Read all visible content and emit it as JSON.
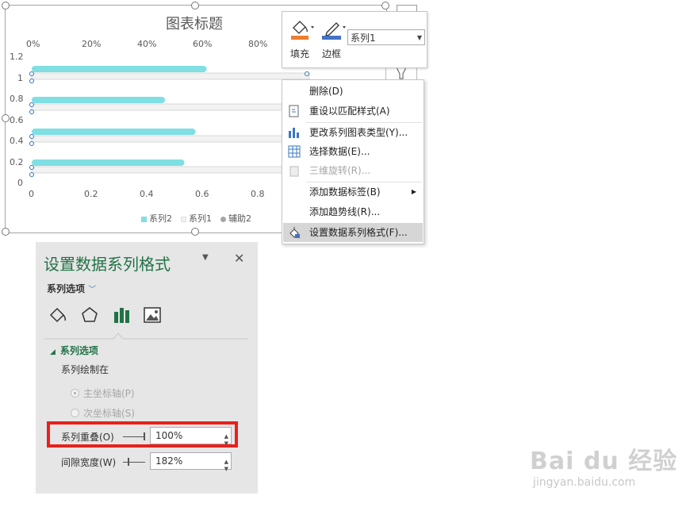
{
  "chart": {
    "title": "图表标题",
    "legend": [
      {
        "name": "系列2",
        "color": "#7fdfe2"
      },
      {
        "name": "系列1",
        "color": "#f2f2f2"
      },
      {
        "name": "辅助2",
        "color": "#a6a6a6"
      }
    ]
  },
  "chart_data": {
    "type": "bar",
    "orientation": "horizontal",
    "title": "图表标题",
    "top_axis_ticks": [
      "0%",
      "20%",
      "40%",
      "60%",
      "80%"
    ],
    "bottom_axis_ticks": [
      "0",
      "0.2",
      "0.4",
      "0.6",
      "0.8"
    ],
    "left_axis_ticks": [
      "1.2",
      "1",
      "0.8",
      "0.6",
      "0.4",
      "0.2",
      "0"
    ],
    "series": [
      {
        "name": "系列2",
        "color": "#7fdfe2",
        "values": [
          0.63,
          0.48,
          0.59,
          0.55
        ]
      },
      {
        "name": "系列1",
        "color": "#f2f2f2",
        "values": [
          1.0,
          1.0,
          1.0,
          1.0
        ]
      }
    ],
    "legend_position": "bottom",
    "grid": false
  },
  "toolbar": {
    "fill_label": "填充",
    "border_label": "边框",
    "series_selected": "系列1",
    "colors": {
      "fill": "#ed7d31",
      "border": "#4472c4"
    }
  },
  "context_menu": {
    "items": [
      {
        "label": "删除(D)",
        "icon": "none",
        "disabled": false
      },
      {
        "label": "重设以匹配样式(A)",
        "icon": "reset-style-icon",
        "disabled": false
      },
      {
        "label": "更改系列图表类型(Y)...",
        "icon": "chart-type-icon",
        "disabled": false
      },
      {
        "label": "选择数据(E)...",
        "icon": "select-data-icon",
        "disabled": false
      },
      {
        "label": "三维旋转(R)...",
        "icon": "rotate-3d-icon",
        "disabled": true
      },
      {
        "label": "添加数据标签(B)",
        "icon": "none",
        "disabled": false
      },
      {
        "label": "添加趋势线(R)...",
        "icon": "none",
        "disabled": false
      },
      {
        "label": "设置数据系列格式(F)...",
        "icon": "format-series-icon",
        "disabled": false
      }
    ]
  },
  "pane": {
    "title": "设置数据系列格式",
    "tab_label": "系列选项",
    "section_header": "系列选项",
    "plot_on_label": "系列绘制在",
    "primary_axis": "主坐标轴(P)",
    "secondary_axis": "次坐标轴(S)",
    "overlap_label": "系列重叠(O)",
    "overlap_value": "100%",
    "gap_label": "间隙宽度(W)",
    "gap_value": "182%",
    "accent_color": "#217346"
  },
  "watermark": {
    "logo": "Bai du 经验",
    "url": "jingyan.baidu.com"
  }
}
